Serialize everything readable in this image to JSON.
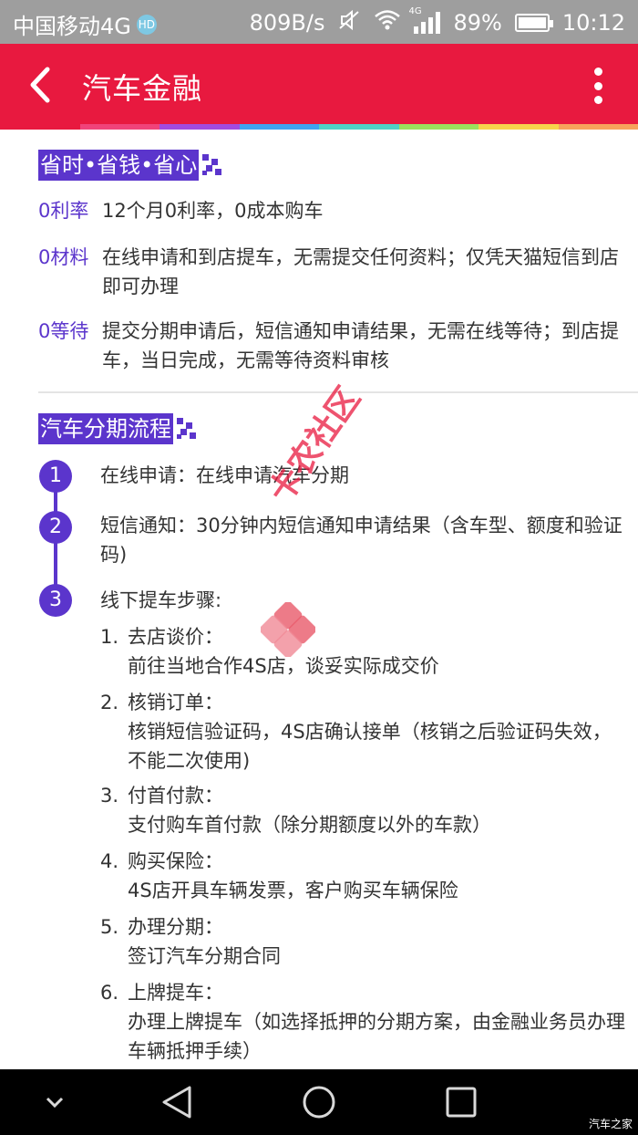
{
  "status_bar": {
    "carrier": "中国移动4G",
    "hd_badge": "HD",
    "speed": "809B/s",
    "network_tag": "4G",
    "battery": "89%",
    "time": "10:12"
  },
  "header": {
    "title": "汽车金融"
  },
  "section1": {
    "title": "省时•省钱•省心",
    "features": [
      {
        "key": "0利率",
        "value": "12个月0利率，0成本购车"
      },
      {
        "key": "0材料",
        "value": "在线申请和到店提车，无需提交任何资料；仅凭天猫短信到店即可办理"
      },
      {
        "key": "0等待",
        "value": "提交分期申请后，短信通知申请结果，无需在线等待；到店提车，当日完成，无需等待资料审核"
      }
    ]
  },
  "section2": {
    "title": "汽车分期流程",
    "steps": [
      {
        "num": "1",
        "text": "在线申请：在线申请汽车分期"
      },
      {
        "num": "2",
        "text": "短信通知：30分钟内短信通知申请结果（含车型、额度和验证码)"
      },
      {
        "num": "3",
        "text": "线下提车步骤:"
      }
    ],
    "sub_steps": [
      {
        "num": "1.",
        "title": "去店谈价：",
        "desc": "前往当地合作4S店，谈妥实际成交价"
      },
      {
        "num": "2.",
        "title": "核销订单：",
        "desc": "核销短信验证码，4S店确认接单（核销之后验证码失效，不能二次使用)"
      },
      {
        "num": "3.",
        "title": "付首付款：",
        "desc": "支付购车首付款（除分期额度以外的车款）"
      },
      {
        "num": "4.",
        "title": "购买保险：",
        "desc": "4S店开具车辆发票，客户购买车辆保险"
      },
      {
        "num": "5.",
        "title": "办理分期：",
        "desc": "签订汽车分期合同"
      },
      {
        "num": "6.",
        "title": "上牌提车：",
        "desc": "办理上牌提车（如选择抵押的分期方案，由金融业务员办理车辆抵押手续）"
      }
    ]
  },
  "watermark": "卡农社区",
  "corner_mark": "汽车之家",
  "colors": {
    "accent": "#5b35cc",
    "header": "#e8193f",
    "status_bar": "#9e9e9e",
    "rainbow": [
      "#e8193f",
      "#f0437a",
      "#a24be0",
      "#3fa3ef",
      "#4fd1c5",
      "#9be15d",
      "#f7d44c",
      "#f7a35c"
    ]
  },
  "icons": {
    "back": "chevron-left-icon",
    "more": "more-vertical-icon",
    "nav_collapse": "chevron-down-icon",
    "nav_back": "triangle-back-icon",
    "nav_home": "circle-home-icon",
    "nav_recent": "square-recent-icon"
  }
}
